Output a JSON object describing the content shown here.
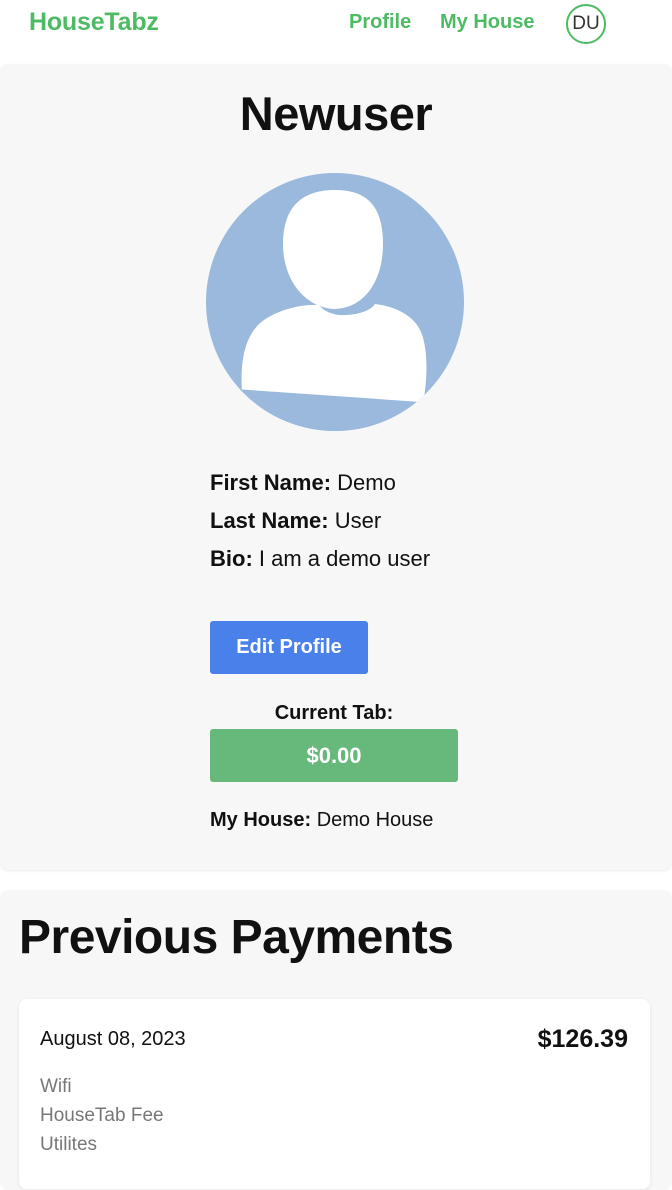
{
  "nav": {
    "brand": "HouseTabz",
    "links": [
      "Profile",
      "My House"
    ],
    "avatar_initials": "DU"
  },
  "profile": {
    "username": "Newuser",
    "avatar_icon": "user-silhouette-icon",
    "first_name_label": "First Name:",
    "first_name": "Demo",
    "last_name_label": "Last Name:",
    "last_name": "User",
    "bio_label": "Bio:",
    "bio": "I am a demo user",
    "edit_button": "Edit Profile",
    "current_tab_label": "Current Tab:",
    "current_tab_amount": "$0.00",
    "house_label": "My House:",
    "house_name": "Demo House"
  },
  "payments": {
    "title": "Previous Payments",
    "items": [
      {
        "date": "August 08, 2023",
        "total": "$126.39",
        "bills": [
          "Wifi",
          "HouseTab Fee",
          "Utilites"
        ]
      }
    ]
  },
  "colors": {
    "brand_green": "#4dbb63",
    "edit_blue": "#4a80ea",
    "tab_green": "#66b97b",
    "avatar_blue": "#9ab9dd",
    "card_bg": "#f7f7f8"
  }
}
